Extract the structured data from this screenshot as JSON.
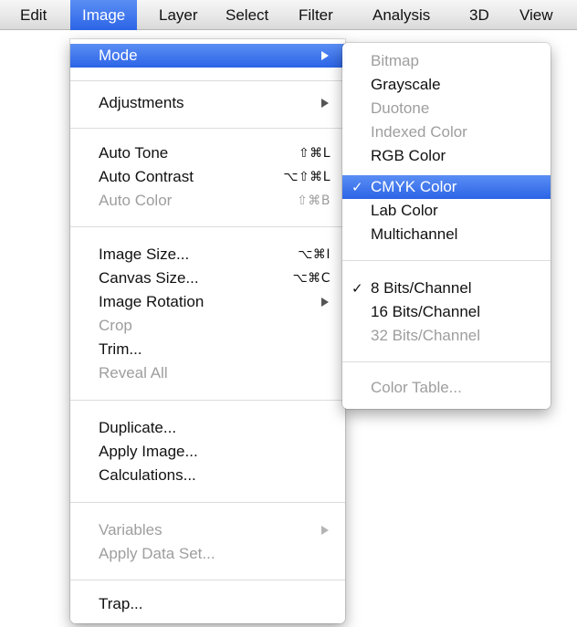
{
  "menubar": {
    "items": [
      "Edit",
      "Image",
      "Layer",
      "Select",
      "Filter",
      "Analysis",
      "3D",
      "View"
    ],
    "active_index": 1
  },
  "image_menu": {
    "items": [
      {
        "label": "Mode",
        "shortcut": "",
        "submenu": true,
        "enabled": true,
        "highlighted": true
      },
      {
        "label": "Adjustments",
        "shortcut": "",
        "submenu": true,
        "enabled": true
      },
      {
        "label": "Auto Tone",
        "shortcut": "⇧⌘L",
        "enabled": true
      },
      {
        "label": "Auto Contrast",
        "shortcut": "⌥⇧⌘L",
        "enabled": true
      },
      {
        "label": "Auto Color",
        "shortcut": "⇧⌘B",
        "enabled": false
      },
      {
        "label": "Image Size...",
        "shortcut": "⌥⌘I",
        "enabled": true
      },
      {
        "label": "Canvas Size...",
        "shortcut": "⌥⌘C",
        "enabled": true
      },
      {
        "label": "Image Rotation",
        "shortcut": "",
        "submenu": true,
        "enabled": true
      },
      {
        "label": "Crop",
        "shortcut": "",
        "enabled": false
      },
      {
        "label": "Trim...",
        "shortcut": "",
        "enabled": true
      },
      {
        "label": "Reveal All",
        "shortcut": "",
        "enabled": false
      },
      {
        "label": "Duplicate...",
        "shortcut": "",
        "enabled": true
      },
      {
        "label": "Apply Image...",
        "shortcut": "",
        "enabled": true
      },
      {
        "label": "Calculations...",
        "shortcut": "",
        "enabled": true
      },
      {
        "label": "Variables",
        "shortcut": "",
        "submenu": true,
        "enabled": false
      },
      {
        "label": "Apply Data Set...",
        "shortcut": "",
        "enabled": false
      },
      {
        "label": "Trap...",
        "shortcut": "",
        "enabled": true
      }
    ]
  },
  "mode_menu": {
    "items": [
      {
        "label": "Bitmap",
        "enabled": false,
        "checked": false
      },
      {
        "label": "Grayscale",
        "enabled": true,
        "checked": false
      },
      {
        "label": "Duotone",
        "enabled": false,
        "checked": false
      },
      {
        "label": "Indexed Color",
        "enabled": false,
        "checked": false
      },
      {
        "label": "RGB Color",
        "enabled": true,
        "checked": false
      },
      {
        "label": "CMYK Color",
        "enabled": true,
        "checked": true,
        "highlighted": true
      },
      {
        "label": "Lab Color",
        "enabled": true,
        "checked": false
      },
      {
        "label": "Multichannel",
        "enabled": true,
        "checked": false
      },
      {
        "label": "8 Bits/Channel",
        "enabled": true,
        "checked": true
      },
      {
        "label": "16 Bits/Channel",
        "enabled": true,
        "checked": false
      },
      {
        "label": "32 Bits/Channel",
        "enabled": false,
        "checked": false
      },
      {
        "label": "Color Table...",
        "enabled": false,
        "checked": false
      }
    ]
  },
  "icons": {
    "check": "✓",
    "submenu_arrow": "submenu-arrow-icon"
  },
  "colors": {
    "highlight": "#2c64e6",
    "disabled_text": "#9e9e9e"
  }
}
